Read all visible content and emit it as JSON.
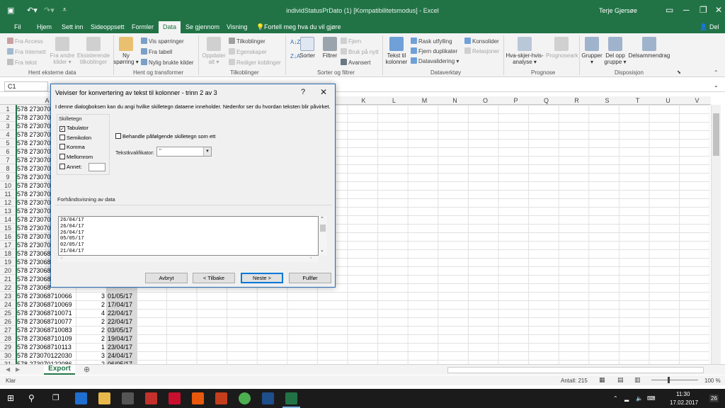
{
  "window": {
    "title": "individStatusPrDato (1) [Kompatibilitetsmodus] - Excel",
    "user": "Terje Gjersøe"
  },
  "tabs": [
    "Fil",
    "Hjem",
    "Sett inn",
    "Sideoppsett",
    "Formler",
    "Data",
    "Se gjennom",
    "Visning"
  ],
  "tell_me": "Fortell meg hva du vil gjøre",
  "share_label": "Del",
  "ribbon": {
    "get_external": {
      "items": [
        "Fra Access",
        "Fra Internett",
        "Fra tekst",
        "Fra andre kilder ▾",
        "Eksisterende tilkoblinger"
      ],
      "label": "Hent eksterne data"
    },
    "get_transform": {
      "new_query": "Ny spørring ▾",
      "items": [
        "Vis spørringer",
        "Fra tabell",
        "Nylig brukte kilder"
      ],
      "label": "Hent og transformer"
    },
    "connections": {
      "refresh": "Oppdater alt ▾",
      "items": [
        "Tilkoblinger",
        "Egenskaper",
        "Rediger koblinger"
      ],
      "label": "Tilkoblinger"
    },
    "sort_filter": {
      "sort": "Sorter",
      "filter": "Filtrer",
      "items": [
        "Fjern",
        "Bruk på nytt",
        "Avansert"
      ],
      "label": "Sorter og filtrer"
    },
    "data_tools": {
      "text_to_columns": "Tekst til kolonner",
      "items": [
        "Rask utfylling",
        "Fjern duplikater",
        "Datavalidering ▾",
        "Konsolider",
        "Relasjoner"
      ],
      "label": "Dataverktøy"
    },
    "forecast": {
      "items": [
        "Hva-skjer-hvis-analyse ▾",
        "Prognoseark"
      ],
      "label": "Prognose"
    },
    "outline": {
      "items": [
        "Grupper ▾",
        "Del opp gruppe ▾",
        "Delsammendrag"
      ],
      "label": "Disposisjon"
    }
  },
  "name_box": "C1",
  "columns": [
    "A",
    "K",
    "L",
    "M",
    "N",
    "O",
    "P",
    "Q",
    "R",
    "S",
    "T",
    "U",
    "V"
  ],
  "rows": [
    {
      "n": "1",
      "a": "578 273070",
      "b": "",
      "c": ""
    },
    {
      "n": "2",
      "a": "578 273070",
      "b": "",
      "c": ""
    },
    {
      "n": "3",
      "a": "578 273070",
      "b": "",
      "c": ""
    },
    {
      "n": "4",
      "a": "578 273070",
      "b": "",
      "c": ""
    },
    {
      "n": "5",
      "a": "578 273070",
      "b": "",
      "c": ""
    },
    {
      "n": "6",
      "a": "578 273070",
      "b": "",
      "c": ""
    },
    {
      "n": "7",
      "a": "578 273070",
      "b": "",
      "c": ""
    },
    {
      "n": "8",
      "a": "578 273070",
      "b": "",
      "c": ""
    },
    {
      "n": "9",
      "a": "578 273070",
      "b": "",
      "c": ""
    },
    {
      "n": "10",
      "a": "578 273070",
      "b": "",
      "c": ""
    },
    {
      "n": "11",
      "a": "578 273070",
      "b": "",
      "c": ""
    },
    {
      "n": "12",
      "a": "578 273070",
      "b": "",
      "c": ""
    },
    {
      "n": "13",
      "a": "578 273070",
      "b": "",
      "c": ""
    },
    {
      "n": "14",
      "a": "578 273070",
      "b": "",
      "c": ""
    },
    {
      "n": "15",
      "a": "578 273070",
      "b": "",
      "c": ""
    },
    {
      "n": "16",
      "a": "578 273070",
      "b": "",
      "c": ""
    },
    {
      "n": "17",
      "a": "578 273070",
      "b": "",
      "c": ""
    },
    {
      "n": "18",
      "a": "578 273068",
      "b": "",
      "c": ""
    },
    {
      "n": "19",
      "a": "578 273068",
      "b": "",
      "c": ""
    },
    {
      "n": "20",
      "a": "578 273068",
      "b": "",
      "c": ""
    },
    {
      "n": "21",
      "a": "578 273068",
      "b": "",
      "c": ""
    },
    {
      "n": "22",
      "a": "578 273068",
      "b": "",
      "c": ""
    },
    {
      "n": "23",
      "a": "578 273068710066",
      "b": "3",
      "c": "01/05/17"
    },
    {
      "n": "24",
      "a": "578 273068710069",
      "b": "2",
      "c": "17/04/17"
    },
    {
      "n": "25",
      "a": "578 273068710071",
      "b": "4",
      "c": "22/04/17"
    },
    {
      "n": "26",
      "a": "578 273068710077",
      "b": "2",
      "c": "22/04/17"
    },
    {
      "n": "27",
      "a": "578 273068710083",
      "b": "2",
      "c": "03/05/17"
    },
    {
      "n": "28",
      "a": "578 273068710109",
      "b": "2",
      "c": "19/04/17"
    },
    {
      "n": "29",
      "a": "578 273068710113",
      "b": "1",
      "c": "23/04/17"
    },
    {
      "n": "30",
      "a": "578 273070122030",
      "b": "3",
      "c": "24/04/17"
    },
    {
      "n": "31",
      "a": "578 273070122086",
      "b": "2",
      "c": "06/05/17"
    }
  ],
  "sheet_tab": "Export",
  "status": {
    "left": "Klar",
    "count": "Antall: 215",
    "zoom": "100 %"
  },
  "taskbar": {
    "time": "11:30",
    "date": "17.02.2017",
    "badge": "26"
  },
  "dialog": {
    "title": "Veiviser for konvertering av tekst til kolonner - trinn 2 av 3",
    "help": "?",
    "close": "✕",
    "description": "I denne dialogboksen kan du angi hvilke skilletegn dataene inneholder. Nedenfor ser du hvordan teksten blir påvirket.",
    "delimiters_label": "Skilletegn",
    "delimiters": [
      {
        "label": "Tabulator",
        "checked": true
      },
      {
        "label": "Semikolon",
        "checked": false
      },
      {
        "label": "Komma",
        "checked": false
      },
      {
        "label": "Mellomrom",
        "checked": false
      },
      {
        "label": "Annet:",
        "checked": false
      }
    ],
    "consecutive": "Behandle påfølgende skilletegn som ett",
    "qualifier_label": "Tekstkvalifikator:",
    "qualifier_value": "\"",
    "preview_label": "Forhåndsvisning av data",
    "preview_lines": [
      "26/04/17",
      "26/04/17",
      "26/04/17",
      "05/05/17",
      "02/05/17",
      "21/04/17"
    ],
    "buttons": {
      "cancel": "Avbryt",
      "back": "< Tilbake",
      "next": "Neste >",
      "finish": "Fullfør"
    }
  },
  "colors": {
    "excel_green": "#217346",
    "dialog_border": "#2b6cb0",
    "selection_gray": "#d9d9d9"
  }
}
